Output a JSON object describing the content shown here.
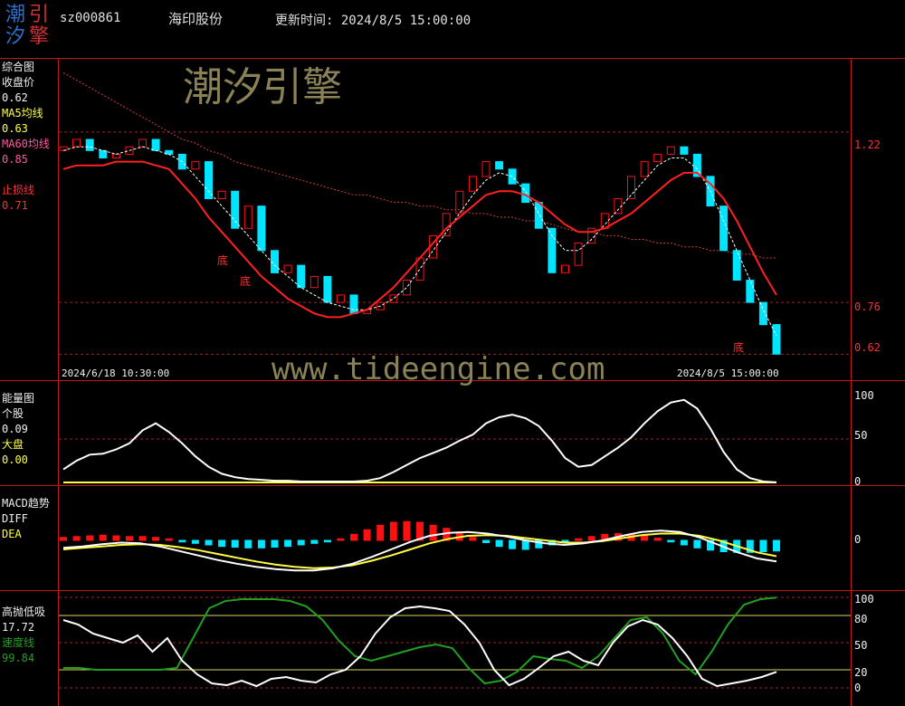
{
  "header": {
    "logo_chars": [
      "潮",
      "引",
      "汐",
      "擎"
    ],
    "stock_code": "sz000861",
    "stock_name": "海印股份",
    "update_label": "更新时间: 2024/8/5 15:00:00"
  },
  "watermark": {
    "text": "潮汐引擎",
    "url": "www.tideengine.com"
  },
  "colors": {
    "up": "#ff1010",
    "down": "#00e5ff",
    "ma5": "#ffffff",
    "ma60": "#d04040",
    "stop": "#ff2020",
    "axis": "#c01818",
    "dea": "#ffff40",
    "speed": "#20a020"
  },
  "main_panel": {
    "labels": [
      {
        "text": "综合图",
        "color": "#f0f0f0"
      },
      {
        "text": "收盘价",
        "color": "#f0f0f0"
      },
      {
        "text": "0.62",
        "color": "#f0f0f0"
      },
      {
        "text": "MA5均线",
        "color": "#ffff40"
      },
      {
        "text": "0.63",
        "color": "#ffff40"
      },
      {
        "text": "MA60均线",
        "color": "#ff5aa0"
      },
      {
        "text": "0.85",
        "color": "#ff5aa0"
      },
      {
        "text": "",
        "color": "#f0f0f0"
      },
      {
        "text": "止损线",
        "color": "#ff3030"
      },
      {
        "text": "0.71",
        "color": "#ff3030"
      }
    ],
    "start_time": "2024/6/18 10:30:00",
    "end_time": "2024/8/5 15:00:00",
    "y_ticks": [
      "1.22",
      "0.76",
      "0.62"
    ],
    "bottom_marks": [
      "底",
      "底",
      "底"
    ]
  },
  "energy_panel": {
    "labels": [
      {
        "text": "能量图",
        "color": "#f0f0f0"
      },
      {
        "text": "个股",
        "color": "#f0f0f0"
      },
      {
        "text": "0.09",
        "color": "#f0f0f0"
      },
      {
        "text": "大盘",
        "color": "#ffff40"
      },
      {
        "text": "0.00",
        "color": "#ffff40"
      }
    ],
    "y_ticks": [
      "100",
      "50",
      "0"
    ]
  },
  "macd_panel": {
    "labels": [
      {
        "text": "MACD趋势",
        "color": "#f0f0f0"
      },
      {
        "text": "DIFF",
        "color": "#f0f0f0"
      },
      {
        "text": "DEA",
        "color": "#ffff40"
      }
    ],
    "y_ticks": [
      "0"
    ]
  },
  "gdx_panel": {
    "labels": [
      {
        "text": "高抛低吸",
        "color": "#f0f0f0"
      },
      {
        "text": "17.72",
        "color": "#f0f0f0"
      },
      {
        "text": "速度线",
        "color": "#20a020"
      },
      {
        "text": "99.84",
        "color": "#20a020"
      }
    ],
    "y_ticks": [
      "100",
      "80",
      "50",
      "20",
      "0"
    ]
  },
  "chart_data": [
    {
      "type": "line",
      "title": "综合图",
      "ylim": [
        0.55,
        1.42
      ],
      "y_ticks": [
        1.22,
        0.76,
        0.62
      ],
      "x_range": [
        "2024/6/18 10:30:00",
        "2024/8/5 15:00:00"
      ],
      "candles_close": [
        1.18,
        1.2,
        1.17,
        1.15,
        1.16,
        1.18,
        1.2,
        1.17,
        1.16,
        1.12,
        1.14,
        1.04,
        1.06,
        0.96,
        1.02,
        0.9,
        0.84,
        0.86,
        0.8,
        0.83,
        0.76,
        0.78,
        0.73,
        0.74,
        0.76,
        0.78,
        0.82,
        0.88,
        0.94,
        1.0,
        1.06,
        1.1,
        1.14,
        1.12,
        1.08,
        1.03,
        0.96,
        0.84,
        0.86,
        0.92,
        0.96,
        1.0,
        1.04,
        1.1,
        1.14,
        1.16,
        1.18,
        1.16,
        1.1,
        1.02,
        0.9,
        0.82,
        0.76,
        0.7,
        0.62
      ],
      "series": [
        {
          "name": "MA5均线",
          "values": [
            1.17,
            1.18,
            1.18,
            1.17,
            1.16,
            1.17,
            1.18,
            1.17,
            1.16,
            1.14,
            1.1,
            1.06,
            1.02,
            0.98,
            0.94,
            0.9,
            0.86,
            0.83,
            0.8,
            0.78,
            0.76,
            0.75,
            0.74,
            0.74,
            0.75,
            0.77,
            0.8,
            0.85,
            0.9,
            0.95,
            1.0,
            1.05,
            1.09,
            1.11,
            1.1,
            1.06,
            1.0,
            0.94,
            0.9,
            0.9,
            0.93,
            0.97,
            1.01,
            1.05,
            1.09,
            1.13,
            1.15,
            1.15,
            1.12,
            1.06,
            0.98,
            0.9,
            0.82,
            0.74,
            0.67
          ]
        },
        {
          "name": "MA60均线",
          "values": [
            1.38,
            1.36,
            1.34,
            1.32,
            1.3,
            1.28,
            1.26,
            1.24,
            1.22,
            1.2,
            1.19,
            1.17,
            1.16,
            1.14,
            1.13,
            1.12,
            1.11,
            1.1,
            1.09,
            1.08,
            1.07,
            1.06,
            1.05,
            1.05,
            1.04,
            1.03,
            1.03,
            1.02,
            1.02,
            1.01,
            1.01,
            1.0,
            1.0,
            0.99,
            0.99,
            0.98,
            0.98,
            0.97,
            0.96,
            0.95,
            0.95,
            0.94,
            0.94,
            0.93,
            0.93,
            0.92,
            0.92,
            0.91,
            0.91,
            0.9,
            0.9,
            0.89,
            0.89,
            0.88,
            0.88
          ]
        },
        {
          "name": "止损线",
          "values": [
            1.12,
            1.13,
            1.13,
            1.13,
            1.14,
            1.14,
            1.14,
            1.13,
            1.12,
            1.08,
            1.04,
            0.99,
            0.95,
            0.91,
            0.87,
            0.83,
            0.8,
            0.77,
            0.75,
            0.73,
            0.72,
            0.72,
            0.73,
            0.74,
            0.77,
            0.8,
            0.84,
            0.88,
            0.92,
            0.96,
            0.99,
            1.02,
            1.05,
            1.06,
            1.06,
            1.05,
            1.03,
            1.0,
            0.97,
            0.95,
            0.95,
            0.96,
            0.98,
            1.0,
            1.03,
            1.06,
            1.09,
            1.11,
            1.11,
            1.08,
            1.04,
            0.98,
            0.91,
            0.84,
            0.78
          ]
        }
      ]
    },
    {
      "type": "line",
      "title": "能量图",
      "ylim": [
        0,
        100
      ],
      "series": [
        {
          "name": "个股",
          "values": [
            15,
            25,
            32,
            33,
            38,
            45,
            60,
            68,
            58,
            45,
            30,
            18,
            10,
            6,
            4,
            3,
            2,
            2,
            1,
            1,
            1,
            1,
            1,
            2,
            5,
            12,
            20,
            28,
            34,
            40,
            48,
            55,
            68,
            75,
            78,
            74,
            65,
            48,
            28,
            18,
            20,
            30,
            40,
            52,
            68,
            82,
            92,
            95,
            85,
            62,
            35,
            15,
            5,
            1,
            0.09
          ]
        },
        {
          "name": "大盘",
          "values": [
            0,
            0,
            0,
            0,
            0,
            0,
            0,
            0,
            0,
            0,
            0,
            0,
            0,
            0,
            0,
            0,
            0,
            0,
            0,
            0,
            0,
            0,
            0,
            0,
            0,
            0,
            0,
            0,
            0,
            0,
            0,
            0,
            0,
            0,
            0,
            0,
            0,
            0,
            0,
            0,
            0,
            0,
            0,
            0,
            0,
            0,
            0,
            0,
            0,
            0,
            0,
            0,
            0,
            0,
            0
          ]
        }
      ]
    },
    {
      "type": "bar",
      "title": "MACD趋势",
      "ylim": [
        -0.06,
        0.06
      ],
      "bars": [
        0.004,
        0.005,
        0.006,
        0.007,
        0.006,
        0.005,
        0.005,
        0.004,
        0.002,
        -0.002,
        -0.004,
        -0.006,
        -0.008,
        -0.009,
        -0.01,
        -0.01,
        -0.009,
        -0.008,
        -0.006,
        -0.004,
        -0.002,
        0.002,
        0.008,
        0.014,
        0.02,
        0.024,
        0.025,
        0.024,
        0.02,
        0.016,
        0.01,
        0.004,
        -0.003,
        -0.008,
        -0.011,
        -0.012,
        -0.01,
        -0.006,
        -0.002,
        0.002,
        0.005,
        0.008,
        0.009,
        0.008,
        0.006,
        0.003,
        -0.002,
        -0.006,
        -0.01,
        -0.013,
        -0.015,
        -0.016,
        -0.016,
        -0.015,
        -0.014
      ],
      "series": [
        {
          "name": "DIFF",
          "values": [
            -0.01,
            -0.008,
            -0.005,
            -0.003,
            -0.004,
            -0.008,
            -0.014,
            -0.02,
            -0.026,
            -0.031,
            -0.035,
            -0.038,
            -0.04,
            -0.04,
            -0.037,
            -0.031,
            -0.022,
            -0.012,
            -0.002,
            0.006,
            0.01,
            0.011,
            0.009,
            0.005,
            0.0,
            -0.004,
            -0.006,
            -0.004,
            0.0,
            0.006,
            0.011,
            0.013,
            0.011,
            0.004,
            -0.006,
            -0.016,
            -0.024,
            -0.028
          ]
        },
        {
          "name": "DEA",
          "values": [
            -0.012,
            -0.01,
            -0.008,
            -0.006,
            -0.005,
            -0.006,
            -0.009,
            -0.013,
            -0.018,
            -0.023,
            -0.028,
            -0.032,
            -0.035,
            -0.037,
            -0.036,
            -0.033,
            -0.027,
            -0.02,
            -0.012,
            -0.004,
            0.002,
            0.006,
            0.007,
            0.006,
            0.003,
            0.0,
            -0.003,
            -0.003,
            -0.001,
            0.003,
            0.007,
            0.009,
            0.009,
            0.006,
            0.0,
            -0.008,
            -0.016,
            -0.021
          ]
        }
      ]
    },
    {
      "type": "line",
      "title": "高抛低吸",
      "ylim": [
        -5,
        105
      ],
      "y_ticks": [
        100,
        80,
        50,
        20,
        0
      ],
      "series": [
        {
          "name": "高抛低吸",
          "values": [
            75,
            70,
            60,
            55,
            50,
            58,
            40,
            55,
            30,
            15,
            5,
            3,
            8,
            2,
            10,
            12,
            8,
            6,
            15,
            20,
            35,
            60,
            78,
            88,
            90,
            88,
            85,
            70,
            50,
            20,
            3,
            10,
            22,
            35,
            40,
            30,
            25,
            50,
            68,
            75,
            70,
            55,
            35,
            10,
            2,
            5,
            8,
            12,
            17.72
          ]
        },
        {
          "name": "速度线",
          "values": [
            22,
            22,
            20,
            20,
            20,
            20,
            20,
            22,
            55,
            88,
            96,
            98,
            98,
            98,
            96,
            90,
            75,
            52,
            35,
            30,
            35,
            40,
            45,
            48,
            44,
            22,
            5,
            8,
            18,
            35,
            32,
            30,
            22,
            35,
            55,
            75,
            78,
            60,
            30,
            15,
            40,
            70,
            92,
            98,
            99.84
          ]
        }
      ]
    }
  ]
}
